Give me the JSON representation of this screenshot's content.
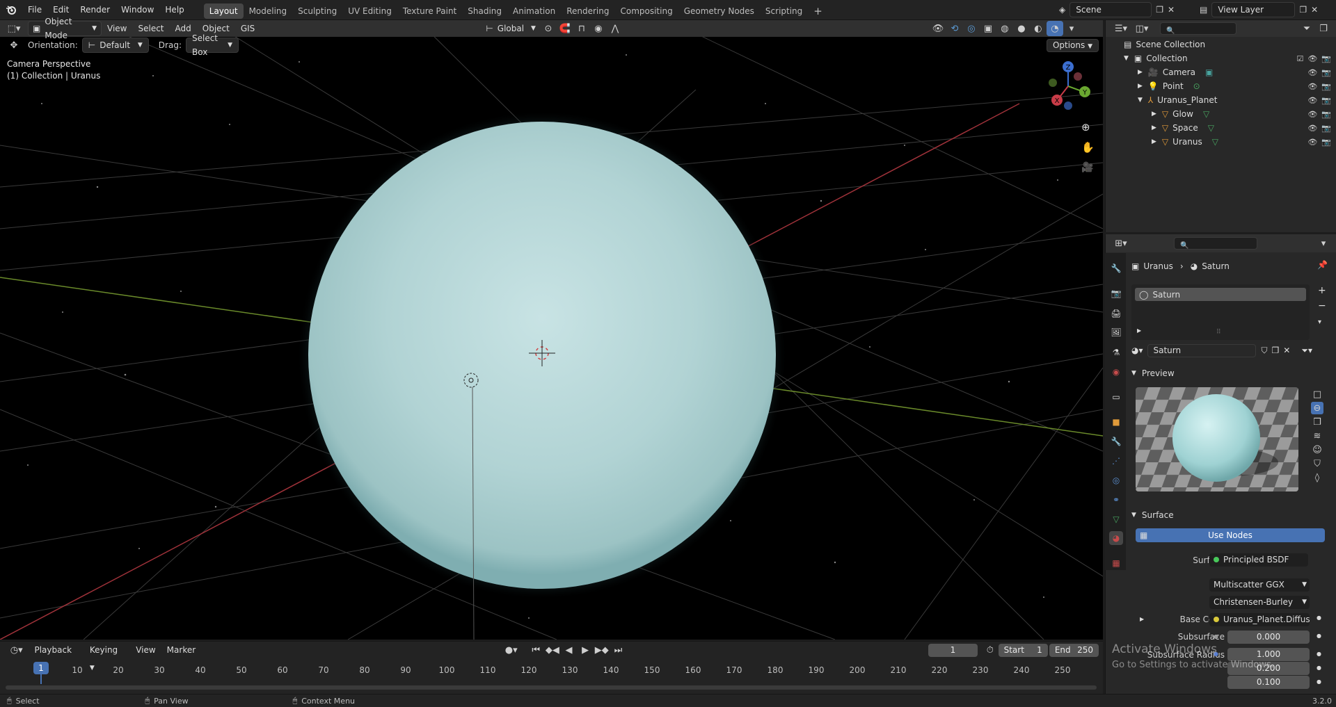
{
  "menubar": {
    "items": [
      "File",
      "Edit",
      "Render",
      "Window",
      "Help"
    ],
    "workspaces": [
      "Layout",
      "Modeling",
      "Sculpting",
      "UV Editing",
      "Texture Paint",
      "Shading",
      "Animation",
      "Rendering",
      "Compositing",
      "Geometry Nodes",
      "Scripting"
    ],
    "active_workspace": "Layout",
    "add_tab": "+",
    "scene": "Scene",
    "view_layer": "View Layer"
  },
  "viewport_header": {
    "mode": "Object Mode",
    "menus": [
      "View",
      "Select",
      "Add",
      "Object",
      "GIS"
    ],
    "transform": "Global",
    "orientation_label": "Orientation:",
    "orientation_value": "Default",
    "drag_label": "Drag:",
    "drag_value": "Select Box",
    "options": "Options"
  },
  "viewport": {
    "camera_text": "Camera Perspective",
    "collection_text": "(1) Collection | Uranus",
    "gizmo_axes": [
      "Z",
      "Y",
      "X"
    ]
  },
  "outliner": {
    "root": "Scene Collection",
    "items": [
      {
        "label": "Collection",
        "depth": 0,
        "icon": "collection-icon"
      },
      {
        "label": "Camera",
        "depth": 1,
        "icon": "camera-icon"
      },
      {
        "label": "Point",
        "depth": 1,
        "icon": "light-icon"
      },
      {
        "label": "Uranus_Planet",
        "depth": 1,
        "icon": "empty-icon"
      },
      {
        "label": "Glow",
        "depth": 2,
        "icon": "mesh-icon"
      },
      {
        "label": "Space",
        "depth": 2,
        "icon": "mesh-icon"
      },
      {
        "label": "Uranus",
        "depth": 2,
        "icon": "mesh-icon"
      }
    ]
  },
  "properties": {
    "breadcrumb_object": "Uranus",
    "breadcrumb_material": "Saturn",
    "slot_name": "Saturn",
    "material_name": "Saturn",
    "preview_panel": "Preview",
    "surface_panel": "Surface",
    "use_nodes": "Use Nodes",
    "surface_label": "Surface",
    "surface_value": "Principled BSDF",
    "distribution": "Multiscatter GGX",
    "subsurface_method": "Christensen-Burley",
    "base_color_label": "Base Color",
    "base_color_value": "Uranus_Planet.Diffuse.jp",
    "subsurface_label": "Subsurface",
    "subsurface_value": "0.000",
    "subsurface_radius_label": "Subsurface Radius",
    "radius_values": [
      "1.000",
      "0.200",
      "0.100"
    ]
  },
  "timeline": {
    "menus": [
      "Playback",
      "Keying",
      "View",
      "Marker"
    ],
    "current_frame": "1",
    "start_label": "Start",
    "start_value": "1",
    "end_label": "End",
    "end_value": "250",
    "frames": [
      "10",
      "20",
      "30",
      "40",
      "50",
      "60",
      "70",
      "80",
      "90",
      "100",
      "110",
      "120",
      "130",
      "140",
      "150",
      "160",
      "170",
      "180",
      "190",
      "200",
      "210",
      "220",
      "230",
      "240",
      "250"
    ],
    "playhead": "1"
  },
  "statusbar": {
    "select": "Select",
    "pan": "Pan View",
    "context": "Context Menu",
    "version": "3.2.0"
  },
  "watermark": {
    "title": "Activate Windows",
    "subtitle": "Go to Settings to activate Windows."
  }
}
